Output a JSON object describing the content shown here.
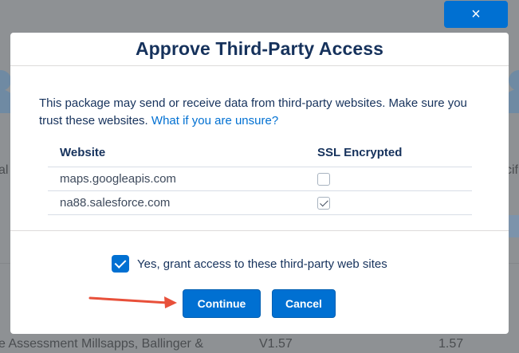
{
  "background": {
    "left_fragment": "al",
    "right_fragment": "cif",
    "bottom_row": {
      "name": "e Assessment Millsapps, Ballinger &",
      "version": "V1.57",
      "version_right": "1.57"
    }
  },
  "close_button": {
    "label": "×"
  },
  "modal": {
    "title": "Approve Third-Party Access",
    "intro_text": "This package may send or receive data from third-party websites. Make sure you trust these websites.",
    "intro_link": "What if you are unsure?",
    "table": {
      "headers": [
        "Website",
        "SSL Encrypted"
      ],
      "rows": [
        {
          "website": "maps.googleapis.com",
          "ssl": false
        },
        {
          "website": "na88.salesforce.com",
          "ssl": true
        }
      ]
    },
    "grant": {
      "label": "Yes, grant access to these third-party web sites",
      "checked": true
    },
    "buttons": {
      "continue": "Continue",
      "cancel": "Cancel"
    }
  },
  "colors": {
    "brand": "#0070d2",
    "title": "#16325c",
    "arrow": "#e8503a"
  }
}
